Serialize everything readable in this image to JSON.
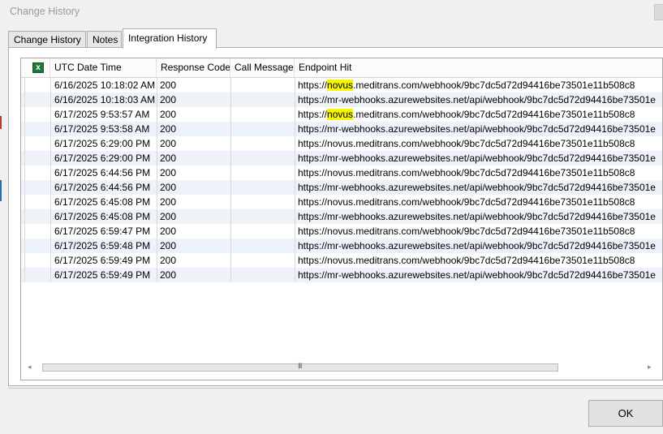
{
  "window": {
    "title": "Change History",
    "ok_label": "OK"
  },
  "tabs": [
    {
      "label": "Change History"
    },
    {
      "label": "Notes"
    },
    {
      "label": "Integration History",
      "active": true
    }
  ],
  "grid": {
    "columns": [
      "UTC Date Time",
      "Response Code",
      "Call Message",
      "Endpoint Hit"
    ],
    "export_icon": "excel-icon",
    "rows": [
      {
        "date": "6/16/2025 10:18:02 AM",
        "code": "200",
        "msg": "",
        "url": "https://novus.meditrans.com/webhook/9bc7dc5d72d94416be73501e11b508c8"
      },
      {
        "date": "6/16/2025 10:18:03 AM",
        "code": "200",
        "msg": "",
        "url": "https://mr-webhooks.azurewebsites.net/api/webhook/9bc7dc5d72d94416be73501e"
      },
      {
        "date": "6/17/2025 9:53:57 AM",
        "code": "200",
        "msg": "",
        "url": "https://novus.meditrans.com/webhook/9bc7dc5d72d94416be73501e11b508c8"
      },
      {
        "date": "6/17/2025 9:53:58 AM",
        "code": "200",
        "msg": "",
        "url": "https://mr-webhooks.azurewebsites.net/api/webhook/9bc7dc5d72d94416be73501e"
      },
      {
        "date": "6/17/2025 6:29:00 PM",
        "code": "200",
        "msg": "",
        "url": "https://novus.meditrans.com/webhook/9bc7dc5d72d94416be73501e11b508c8"
      },
      {
        "date": "6/17/2025 6:29:00 PM",
        "code": "200",
        "msg": "",
        "url": "https://mr-webhooks.azurewebsites.net/api/webhook/9bc7dc5d72d94416be73501e"
      },
      {
        "date": "6/17/2025 6:44:56 PM",
        "code": "200",
        "msg": "",
        "url": "https://novus.meditrans.com/webhook/9bc7dc5d72d94416be73501e11b508c8"
      },
      {
        "date": "6/17/2025 6:44:56 PM",
        "code": "200",
        "msg": "",
        "url": "https://mr-webhooks.azurewebsites.net/api/webhook/9bc7dc5d72d94416be73501e"
      },
      {
        "date": "6/17/2025 6:45:08 PM",
        "code": "200",
        "msg": "",
        "url": "https://novus.meditrans.com/webhook/9bc7dc5d72d94416be73501e11b508c8"
      },
      {
        "date": "6/17/2025 6:45:08 PM",
        "code": "200",
        "msg": "",
        "url": "https://mr-webhooks.azurewebsites.net/api/webhook/9bc7dc5d72d94416be73501e"
      },
      {
        "date": "6/17/2025 6:59:47 PM",
        "code": "200",
        "msg": "",
        "url": "https://novus.meditrans.com/webhook/9bc7dc5d72d94416be73501e11b508c8"
      },
      {
        "date": "6/17/2025 6:59:48 PM",
        "code": "200",
        "msg": "",
        "url": "https://mr-webhooks.azurewebsites.net/api/webhook/9bc7dc5d72d94416be73501e"
      },
      {
        "date": "6/17/2025 6:59:49 PM",
        "code": "200",
        "msg": "",
        "url": "https://novus.meditrans.com/webhook/9bc7dc5d72d94416be73501e11b508c8"
      },
      {
        "date": "6/17/2025 6:59:49 PM",
        "code": "200",
        "msg": "",
        "url": "https://mr-webhooks.azurewebsites.net/api/webhook/9bc7dc5d72d94416be73501e"
      }
    ]
  },
  "scrollbar": {
    "grip": "III"
  },
  "colors": {
    "highlight": "#f7f700",
    "row_alt": "#eef3fa",
    "excel": "#1f7a3a"
  }
}
